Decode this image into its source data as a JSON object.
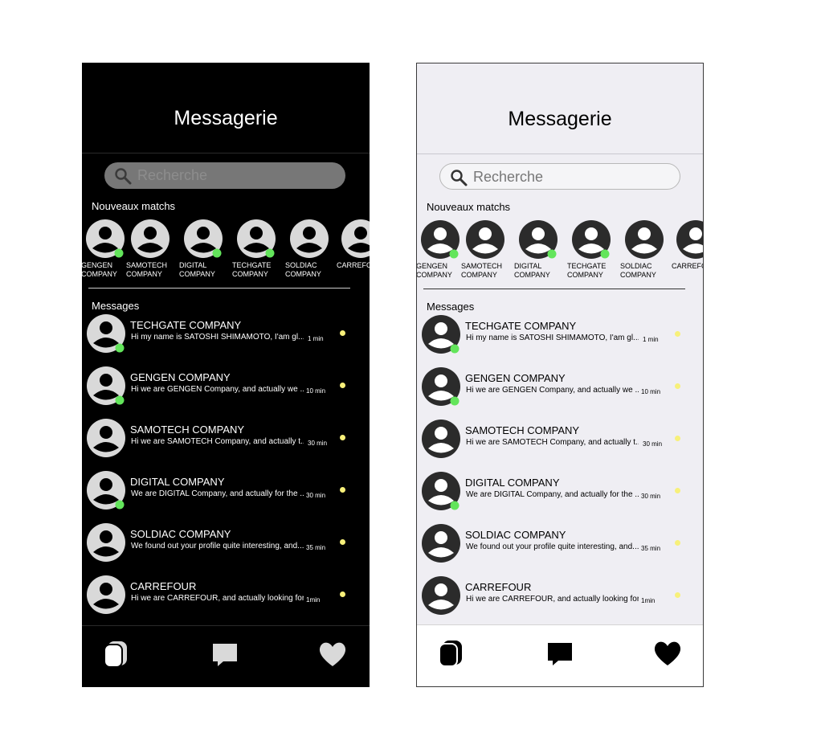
{
  "screens": [
    {
      "theme": "dark",
      "title": "Messagerie",
      "search_placeholder": "Recherche",
      "new_matches_label": "Nouveaux matchs",
      "messages_label": "Messages",
      "colors": {
        "background": "#000000",
        "avatar_bg": "#d9d9d9",
        "avatar_fg": "#000000",
        "online": "#63e55b",
        "unread": "#f7f07a",
        "icons": "#d9d9d9"
      },
      "matches": [
        {
          "name_line1": "GENGEN",
          "name_line2": "COMPANY",
          "online": true
        },
        {
          "name_line1": "SAMOTECH",
          "name_line2": "COMPANY",
          "online": false
        },
        {
          "name_line1": "DIGITAL",
          "name_line2": "COMPANY",
          "online": true
        },
        {
          "name_line1": "TECHGATE",
          "name_line2": "COMPANY",
          "online": true
        },
        {
          "name_line1": "SOLDIAC",
          "name_line2": "COMPANY",
          "online": false
        },
        {
          "name_line1": "CARREFOUR",
          "name_line2": "",
          "online": false
        }
      ],
      "messages": [
        {
          "name": "TECHGATE COMPANY",
          "preview": "Hi my name is SATOSHI SHIMAMOTO, I'am gl...",
          "time": "1 min",
          "online": true,
          "unread": true
        },
        {
          "name": "GENGEN COMPANY",
          "preview": "Hi we are GENGEN Company, and actually we ....",
          "time": "10 min",
          "online": true,
          "unread": true
        },
        {
          "name": "SAMOTECH COMPANY",
          "preview": "Hi we are SAMOTECH Company, and actually t...",
          "time": "30 min",
          "online": false,
          "unread": true
        },
        {
          "name": "DIGITAL COMPANY",
          "preview": "We are DIGITAL Company, and actually for the ...",
          "time": "30 min",
          "online": true,
          "unread": true
        },
        {
          "name": "SOLDIAC COMPANY",
          "preview": "We found out your profile quite interesting, and...",
          "time": "35 min",
          "online": false,
          "unread": true
        },
        {
          "name": "CARREFOUR",
          "preview": "Hi we are CARREFOUR, and actually looking for..",
          "time": "1min",
          "online": false,
          "unread": true
        }
      ],
      "tabs": [
        {
          "icon": "cards-icon",
          "active": true
        },
        {
          "icon": "chat-bubble-icon",
          "active": false
        },
        {
          "icon": "heart-icon",
          "active": false
        }
      ]
    },
    {
      "theme": "light",
      "title": "Messagerie",
      "search_placeholder": "Recherche",
      "new_matches_label": "Nouveaux matchs",
      "messages_label": "Messages",
      "colors": {
        "background": "#efeef3",
        "avatar_bg": "#2b2b2b",
        "avatar_fg": "#ffffff",
        "online": "#63e55b",
        "unread": "#f7f07a",
        "icons": "#000000"
      },
      "matches": [
        {
          "name_line1": "GENGEN",
          "name_line2": "COMPANY",
          "online": true
        },
        {
          "name_line1": "SAMOTECH",
          "name_line2": "COMPANY",
          "online": false
        },
        {
          "name_line1": "DIGITAL",
          "name_line2": "COMPANY",
          "online": true
        },
        {
          "name_line1": "TECHGATE",
          "name_line2": "COMPANY",
          "online": true
        },
        {
          "name_line1": "SOLDIAC",
          "name_line2": "COMPANY",
          "online": false
        },
        {
          "name_line1": "CARREFOUR",
          "name_line2": "",
          "online": false
        }
      ],
      "messages": [
        {
          "name": "TECHGATE COMPANY",
          "preview": "Hi my name is SATOSHI SHIMAMOTO, I'am gl...",
          "time": "1 min",
          "online": true,
          "unread": true
        },
        {
          "name": "GENGEN COMPANY",
          "preview": "Hi we are GENGEN Company, and actually we ....",
          "time": "10 min",
          "online": true,
          "unread": true
        },
        {
          "name": "SAMOTECH COMPANY",
          "preview": "Hi we are SAMOTECH Company, and actually t...",
          "time": "30 min",
          "online": false,
          "unread": true
        },
        {
          "name": "DIGITAL COMPANY",
          "preview": "We are DIGITAL Company, and actually for the ...",
          "time": "30 min",
          "online": true,
          "unread": true
        },
        {
          "name": "SOLDIAC COMPANY",
          "preview": "We found out your profile quite interesting, and...",
          "time": "35 min",
          "online": false,
          "unread": true
        },
        {
          "name": "CARREFOUR",
          "preview": "Hi we are CARREFOUR, and actually looking for..",
          "time": "1min",
          "online": false,
          "unread": true
        }
      ],
      "tabs": [
        {
          "icon": "cards-icon",
          "active": true
        },
        {
          "icon": "chat-bubble-icon",
          "active": false
        },
        {
          "icon": "heart-icon",
          "active": false
        }
      ]
    }
  ]
}
